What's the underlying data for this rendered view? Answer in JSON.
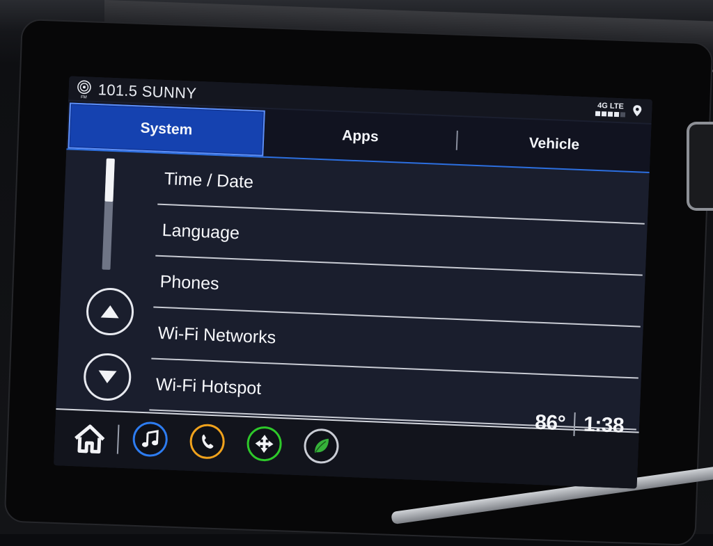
{
  "status": {
    "band": "FM",
    "station": "101.5 SUNNY",
    "network": "4G LTE"
  },
  "tabs": [
    {
      "label": "System",
      "active": true
    },
    {
      "label": "Apps",
      "active": false
    },
    {
      "label": "Vehicle",
      "active": false
    }
  ],
  "menu": {
    "items": [
      {
        "label": "Time / Date"
      },
      {
        "label": "Language"
      },
      {
        "label": "Phones"
      },
      {
        "label": "Wi-Fi Networks"
      },
      {
        "label": "Wi-Fi Hotspot"
      }
    ],
    "scroll_position": 0
  },
  "footer": {
    "temperature": "86°",
    "time": "1:38"
  },
  "icons": {
    "radio": "radio-icon",
    "location": "location-pin-icon",
    "scroll_up": "arrow-up-icon",
    "scroll_down": "arrow-down-icon",
    "home": "home-icon",
    "audio": "music-note-icon",
    "phone": "phone-icon",
    "navigation": "navigation-icon",
    "energy": "leaf-icon"
  },
  "colors": {
    "active_tab": "#1542b0",
    "audio": "#2d7cf0",
    "phone": "#f0a21c",
    "navigation": "#2ec92a",
    "energy": "#36b23a"
  }
}
